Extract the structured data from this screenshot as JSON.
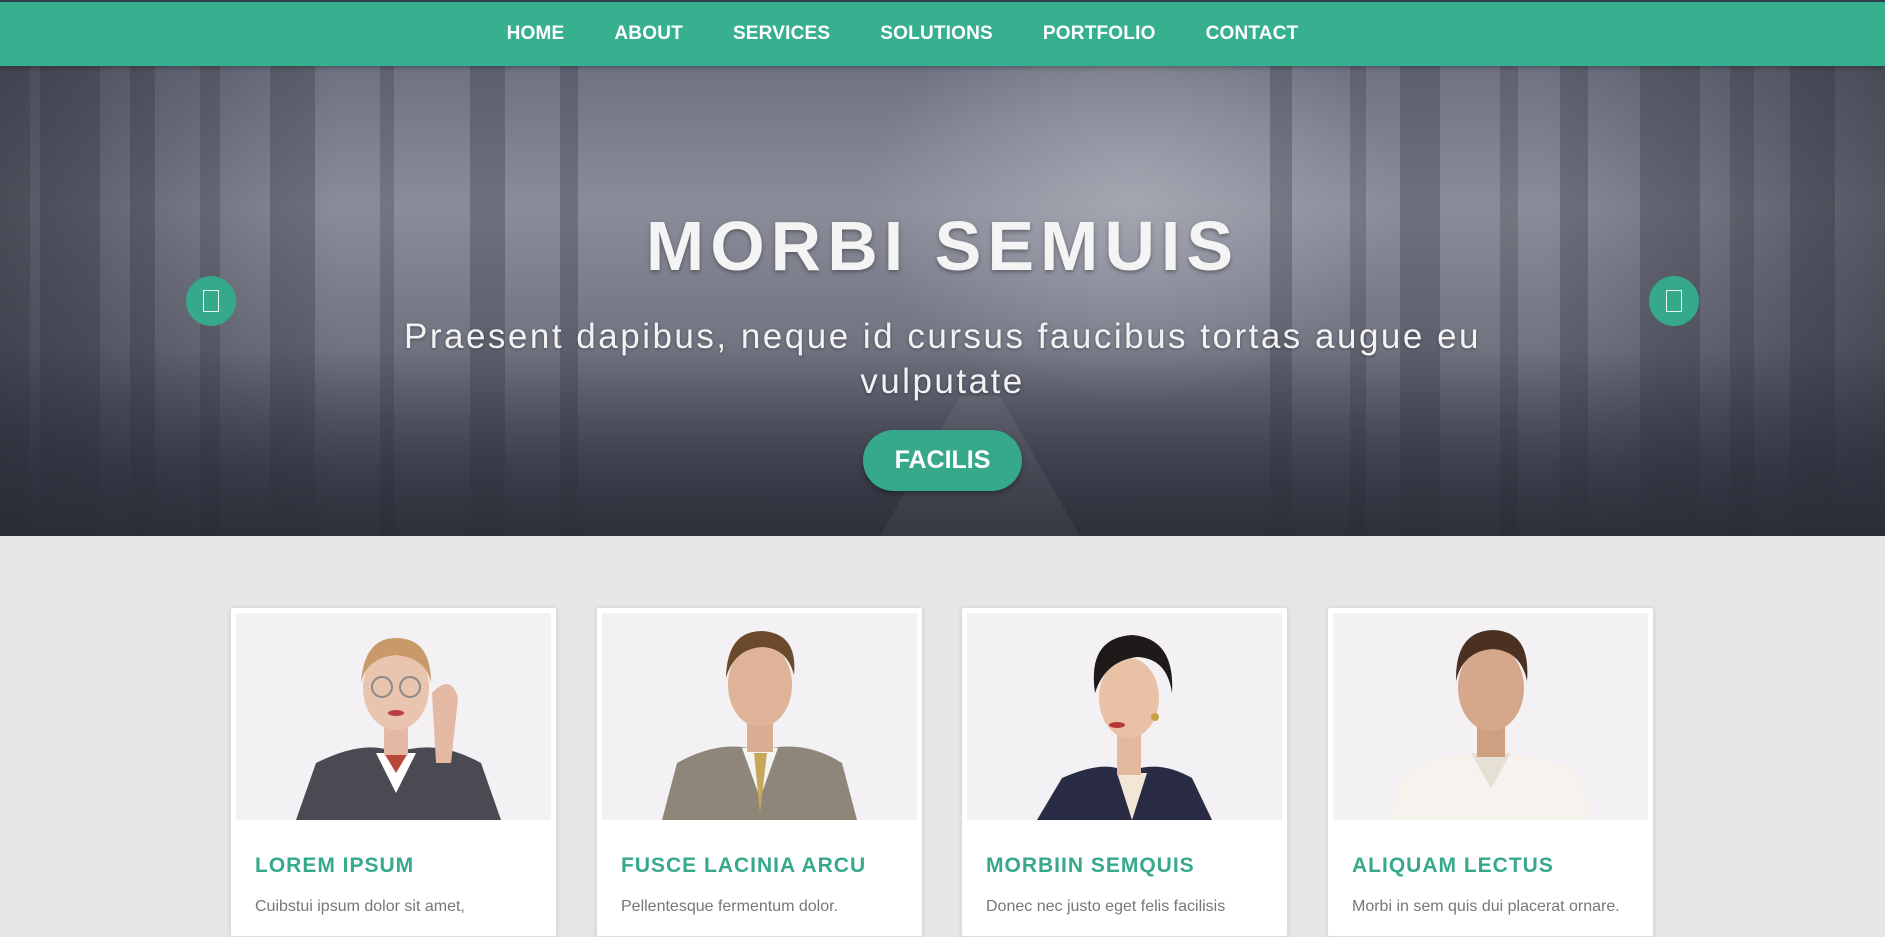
{
  "nav": {
    "items": [
      "HOME",
      "ABOUT",
      "SERVICES",
      "SOLUTIONS",
      "PORTFOLIO",
      "CONTACT"
    ]
  },
  "hero": {
    "title": "MORBI SEMUIS",
    "subtitle": "Praesent dapibus, neque id cursus faucibus tortas augue eu vulputate",
    "button_label": "FACILIS",
    "prev_icon": "chevron-left-icon",
    "next_icon": "chevron-right-icon"
  },
  "cards": [
    {
      "title": "LOREM IPSUM",
      "text": "Cuibstui ipsum dolor sit amet,",
      "photo": "businesswoman-with-glasses"
    },
    {
      "title": "FUSCE LACINIA ARCU",
      "text": "Pellentesque fermentum dolor.",
      "photo": "businessman-in-suit"
    },
    {
      "title": "MORBIIN SEMQUIS",
      "text": "Donec nec justo eget felis facilisis",
      "photo": "businesswoman-smiling"
    },
    {
      "title": "ALIQUAM LECTUS",
      "text": "Morbi in sem quis dui placerat ornare.",
      "photo": "man-in-polo-shirt"
    }
  ],
  "colors": {
    "accent": "#37b08f",
    "button": "#37a98b",
    "page_background": "#e6e6e6"
  }
}
